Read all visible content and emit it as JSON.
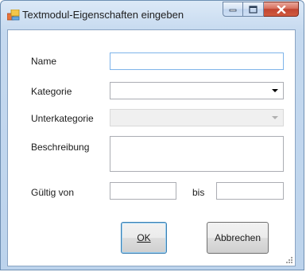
{
  "window": {
    "title": "Textmodul-Eigenschaften eingeben",
    "buttons": {
      "minimize": "minimize",
      "maximize": "maximize",
      "close": "close"
    }
  },
  "form": {
    "name_label": "Name",
    "name_value": "",
    "kategorie_label": "Kategorie",
    "kategorie_value": "",
    "unterkategorie_label": "Unterkategorie",
    "unterkategorie_value": "",
    "beschreibung_label": "Beschreibung",
    "beschreibung_value": "",
    "gueltig_von_label": "Gültig von",
    "gueltig_von_value": "",
    "bis_label": "bis",
    "bis_value": ""
  },
  "actions": {
    "ok_label": "OK",
    "cancel_label": "Abbrechen"
  },
  "icons": {
    "app": "form-icon",
    "minimize": "minimize-icon",
    "maximize": "maximize-icon",
    "close": "close-icon",
    "dropdown": "chevron-down-icon",
    "resize": "resize-grip-icon"
  },
  "colors": {
    "title_gradient_top": "#dce9f7",
    "close_button": "#c14531",
    "focus_border": "#7eb4ea"
  }
}
